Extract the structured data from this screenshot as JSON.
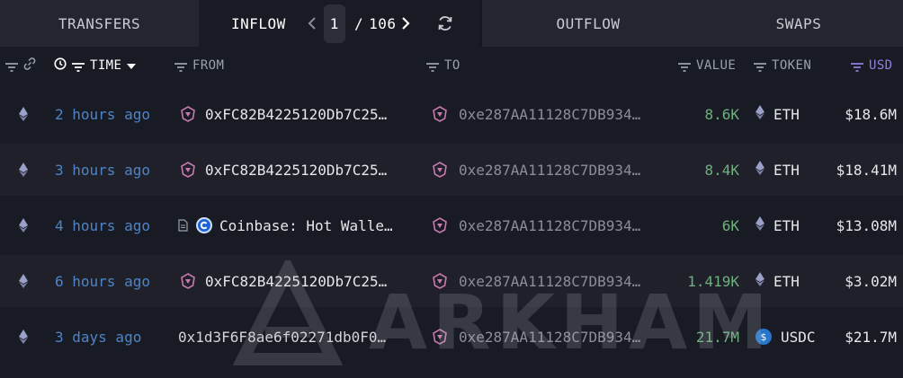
{
  "tabs": {
    "transfers": "TRANSFERS",
    "inflow": "INFLOW",
    "outflow": "OUTFLOW",
    "swaps": "SWAPS"
  },
  "pager": {
    "current": "1",
    "separator": "/",
    "total": "106"
  },
  "columns": {
    "time": "TIME",
    "from": "FROM",
    "to": "TO",
    "value": "VALUE",
    "token": "TOKEN",
    "usd": "USD"
  },
  "rows": [
    {
      "time": "2 hours ago",
      "from": "0xFC82B4225120Db7C25…",
      "to": "0xe287AA11128C7DB934…",
      "value": "8.6K",
      "token": "ETH",
      "usd": "$18.6M"
    },
    {
      "time": "3 hours ago",
      "from": "0xFC82B4225120Db7C25…",
      "to": "0xe287AA11128C7DB934…",
      "value": "8.4K",
      "token": "ETH",
      "usd": "$18.41M"
    },
    {
      "time": "4 hours ago",
      "from": "Coinbase: Hot Walle…",
      "to": "0xe287AA11128C7DB934…",
      "value": "6K",
      "token": "ETH",
      "usd": "$13.08M"
    },
    {
      "time": "6 hours ago",
      "from": "0xFC82B4225120Db7C25…",
      "to": "0xe287AA11128C7DB934…",
      "value": "1.419K",
      "token": "ETH",
      "usd": "$3.02M"
    },
    {
      "time": "3 days ago",
      "from": "0x1d3F6F8ae6f02271db0F0…",
      "to": "0xe287AA11128C7DB934…",
      "value": "21.7M",
      "token": "USDC",
      "usd": "$21.7M"
    }
  ],
  "watermark": "ARKHAM",
  "colors": {
    "value_green": "#6cb07d",
    "time_blue": "#4d84c9",
    "usd_filter_purple": "#8f7fe0",
    "entity_icon_pink": "#c77ab0"
  }
}
